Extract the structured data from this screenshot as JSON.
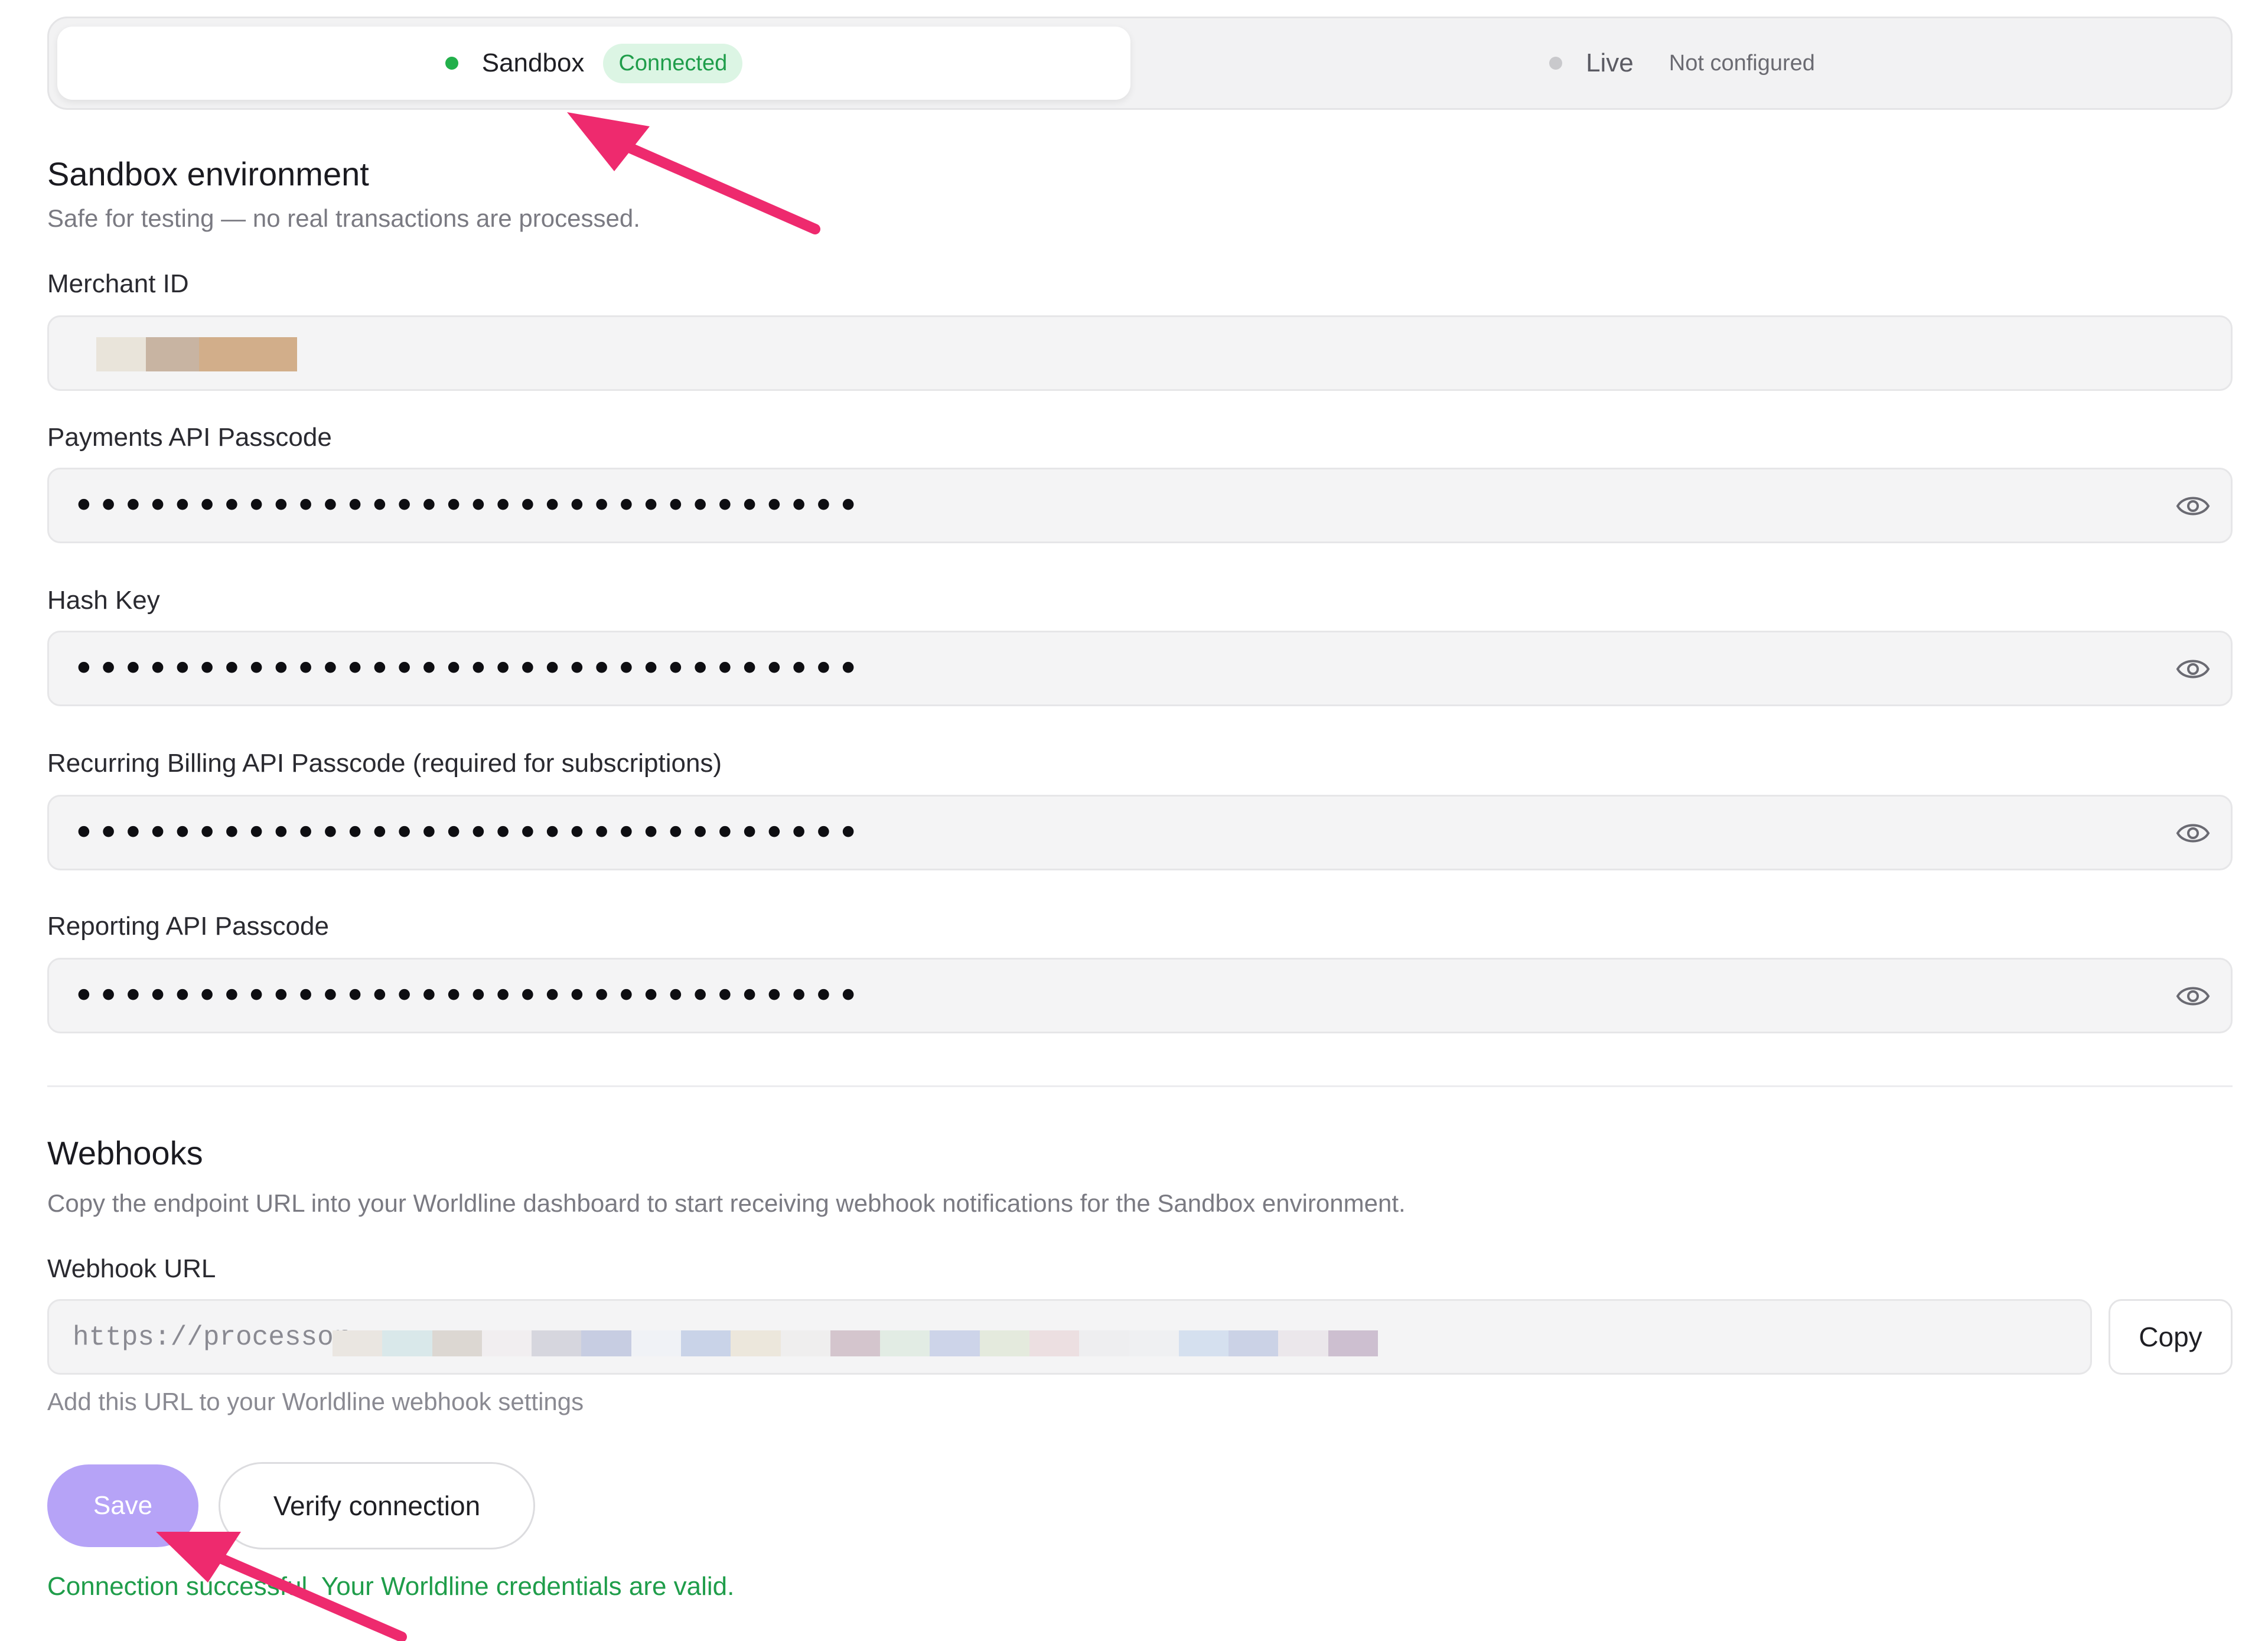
{
  "environment_toggle": {
    "sandbox": {
      "label": "Sandbox",
      "status": "Connected",
      "dot_color": "#22b04b"
    },
    "live": {
      "label": "Live",
      "status": "Not configured",
      "dot_color": "#c9c9cc"
    }
  },
  "sandbox_section": {
    "title": "Sandbox environment",
    "description": "Safe for testing — no real transactions are processed."
  },
  "fields": {
    "merchant_id": {
      "label": "Merchant ID"
    },
    "payments_passcode": {
      "label": "Payments API Passcode",
      "value": "••••••••••••••••••••••••••••••••"
    },
    "hash_key": {
      "label": "Hash Key",
      "value": "••••••••••••••••••••••••••••••••"
    },
    "recurring_passcode": {
      "label": "Recurring Billing API Passcode (required for subscriptions)",
      "value": "••••••••••••••••••••••••••••••••"
    },
    "reporting_passcode": {
      "label": "Reporting API Passcode",
      "value": "••••••••••••••••••••••••••••••••"
    }
  },
  "webhooks": {
    "title": "Webhooks",
    "description": "Copy the endpoint URL into your Worldline dashboard to start receiving webhook notifications for the Sandbox environment.",
    "url_label": "Webhook URL",
    "url_prefix": "https://processor-",
    "copy_label": "Copy",
    "hint": "Add this URL to your Worldline webhook settings"
  },
  "actions": {
    "save_label": "Save",
    "verify_label": "Verify connection"
  },
  "status": {
    "message": "Connection successful. Your Worldline credentials are valid.",
    "color": "#1f9d4a"
  },
  "colors": {
    "accent": "#b6a3f7",
    "badge_bg": "#dcf5e4",
    "badge_text": "#1f9d4a",
    "annotation_arrow": "#ee2a6e"
  }
}
